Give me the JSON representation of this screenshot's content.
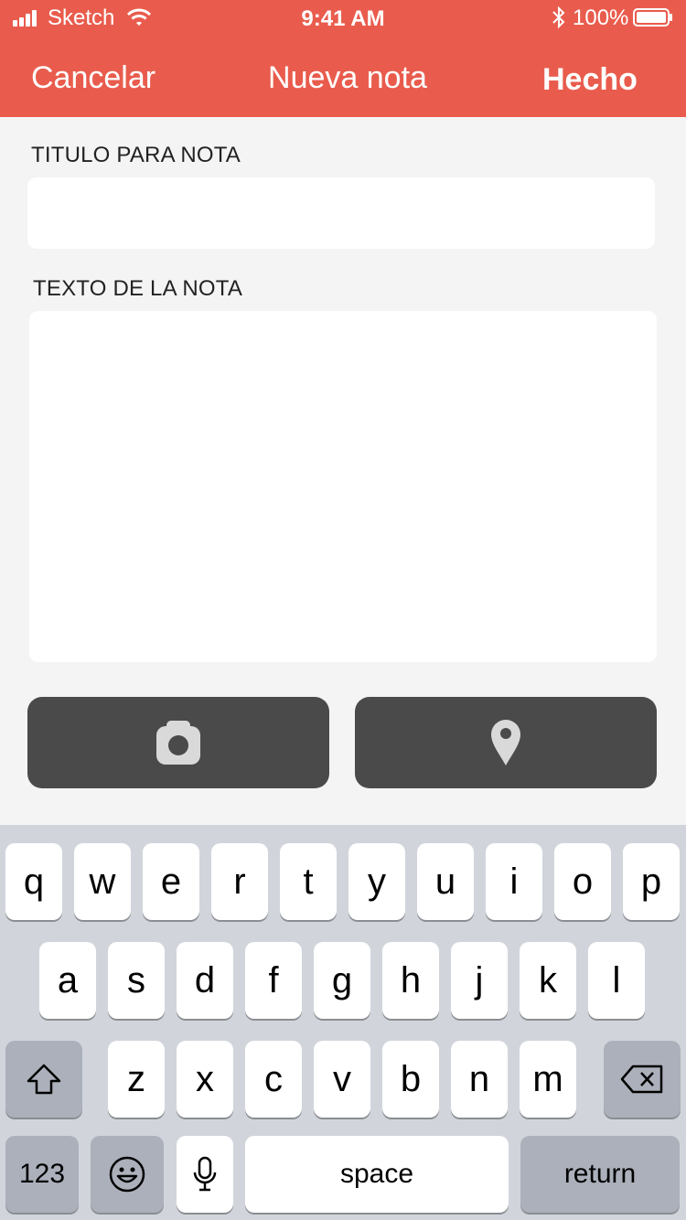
{
  "status_bar": {
    "carrier": "Sketch",
    "time": "9:41 AM",
    "battery": "100%"
  },
  "nav": {
    "cancel": "Cancelar",
    "title": "Nueva nota",
    "done": "Hecho"
  },
  "form": {
    "title_label": "TITULO PARA NOTA",
    "title_value": "",
    "text_label": "TEXTO DE LA NOTA",
    "text_value": ""
  },
  "actions": {
    "camera_icon": "camera-icon",
    "location_icon": "location-pin-icon"
  },
  "colors": {
    "accent": "#e95c4d",
    "button_dark": "#4a4a4a",
    "background": "#f4f4f4",
    "keyboard": "#d1d5db"
  },
  "keyboard": {
    "row1": [
      "q",
      "w",
      "e",
      "r",
      "t",
      "y",
      "u",
      "i",
      "o",
      "p"
    ],
    "row2": [
      "a",
      "s",
      "d",
      "f",
      "g",
      "h",
      "j",
      "k",
      "l"
    ],
    "row3": [
      "z",
      "x",
      "c",
      "v",
      "b",
      "n",
      "m"
    ],
    "numbers": "123",
    "space": "space",
    "return": "return"
  }
}
